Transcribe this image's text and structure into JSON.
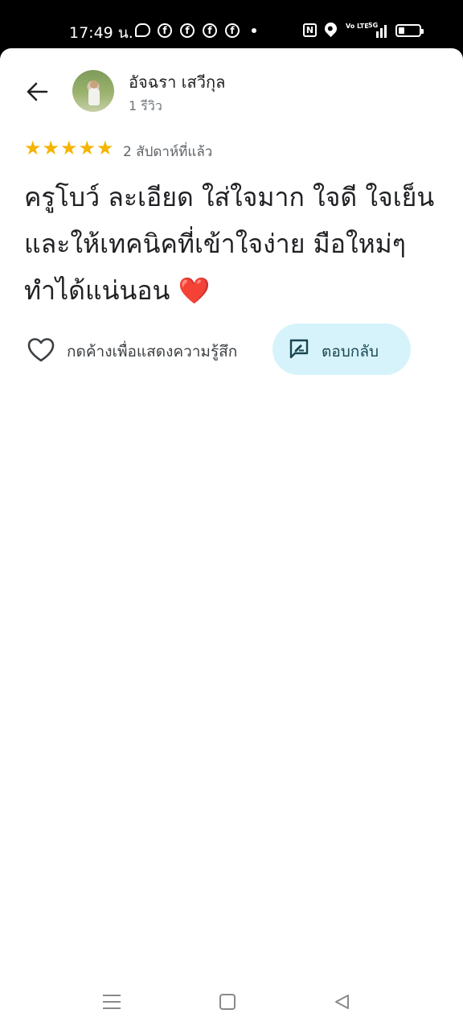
{
  "status_bar": {
    "time": "17:49 น.",
    "icons": [
      "chat-icon",
      "facebook-icon",
      "facebook-icon",
      "facebook-icon",
      "facebook-icon",
      "more-dot-icon",
      "nfc-icon",
      "location-icon",
      "volte-icon",
      "5g-signal-icon",
      "battery-icon"
    ],
    "volte": "Vo LTE",
    "network": "5G",
    "battery_level": 0.3
  },
  "review": {
    "user_name": "อัจฉรา เสวีกุล",
    "user_review_count": "1 รีวิว",
    "rating": 5,
    "max_rating": 5,
    "star_color": "#f5b400",
    "time_ago": "2 สัปดาห์ที่แล้ว",
    "text": "ครูโบว์ ละเอียด ใส่ใจมาก ใจดี ใจเย็น และให้เทคนิคที่เข้าใจง่าย มือใหม่ๆ ทำได้แน่นอน",
    "emoji": "❤️"
  },
  "actions": {
    "like_label": "กดค้างเพื่อแสดงความรู้สึก",
    "reply_label": "ตอบกลับ",
    "reply_bg": "#d6f3fb"
  },
  "nav": {
    "icons": [
      "menu-icon",
      "home-icon",
      "back-icon"
    ]
  }
}
